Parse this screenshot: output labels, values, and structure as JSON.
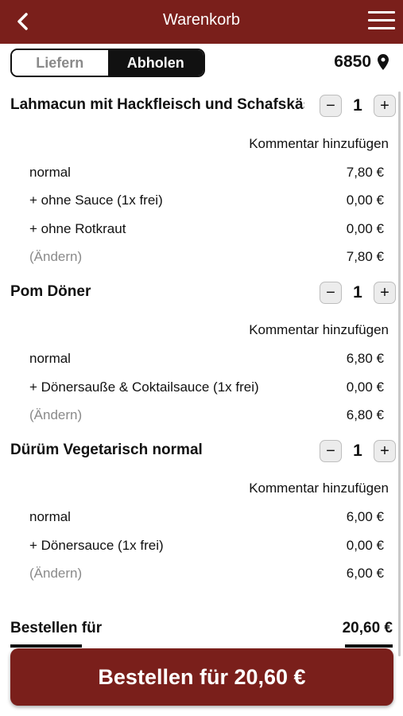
{
  "header": {
    "title": "Warenkorb",
    "back_icon": "chevron-left-icon",
    "menu_icon": "hamburger-menu-icon",
    "color": "#7a1f1b"
  },
  "mode": {
    "deliver_label": "Liefern",
    "pickup_label": "Abholen",
    "selected": "Abholen"
  },
  "location": {
    "postal_code": "6850",
    "icon": "map-pin-icon"
  },
  "items": [
    {
      "name": "Lahmacun mit Hackfleisch und Schafskäse",
      "quantity": "1",
      "comment_label": "Kommentar hinzufügen",
      "lines": [
        {
          "label": "normal",
          "price": "7,80 €"
        },
        {
          "label": "+ ohne Sauce (1x frei)",
          "price": "0,00 €"
        },
        {
          "label": "+ ohne Rotkraut",
          "price": "0,00 €"
        }
      ],
      "change_label": "(Ändern)",
      "subtotal": "7,80 €"
    },
    {
      "name": "Pom Döner",
      "quantity": "1",
      "comment_label": "Kommentar hinzufügen",
      "lines": [
        {
          "label": "normal",
          "price": "6,80 €"
        },
        {
          "label": "+ Dönersauße & Coktailsauce (1x frei)",
          "price": "0,00 €"
        }
      ],
      "change_label": "(Ändern)",
      "subtotal": "6,80 €"
    },
    {
      "name": "Dürüm Vegetarisch normal",
      "quantity": "1",
      "comment_label": "Kommentar hinzufügen",
      "lines": [
        {
          "label": "normal",
          "price": "6,00 €"
        },
        {
          "label": "+ Dönersauce (1x frei)",
          "price": "0,00 €"
        }
      ],
      "change_label": "(Ändern)",
      "subtotal": "6,00 €"
    }
  ],
  "qty_controls": {
    "minus": "−",
    "plus": "+"
  },
  "summary": {
    "label": "Bestellen für",
    "total": "20,60 €"
  },
  "order_button": {
    "label": "Bestellen für 20,60 €"
  }
}
